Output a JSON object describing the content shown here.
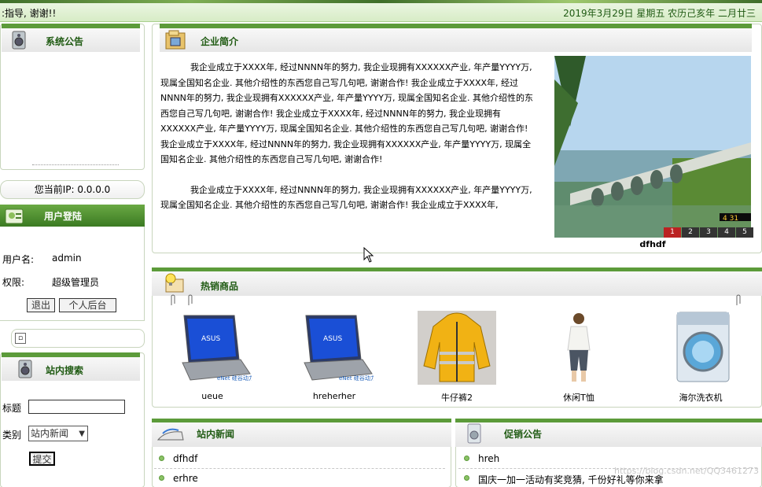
{
  "topbar": {
    "marquee": ":指导, 谢谢!!",
    "date": "2019年3月29日  星期五  农历己亥年  二月廿三"
  },
  "sidebar": {
    "notice_title": "系统公告",
    "ip_label": "您当前IP: 0.0.0.0",
    "login": {
      "title": "用户登陆",
      "username_label": "用户名:",
      "username_value": "admin",
      "role_label": "权限:",
      "role_value": "超级管理员",
      "logout_button": "退出",
      "backend_button": "个人后台"
    },
    "small_box_glyph": "▫",
    "search": {
      "title": "站内搜索",
      "title_label": "标题",
      "title_value": "",
      "category_label": "类别",
      "category_selected": "站内新闻",
      "submit_button": "提交"
    }
  },
  "intro": {
    "title": "企业简介",
    "paragraphs": [
      "我企业成立于XXXX年, 经过NNNN年的努力, 我企业现拥有XXXXXX产业, 年产量YYYY万, 现属全国知名企业. 其他介绍性的东西您自己写几句吧, 谢谢合作! 我企业成立于XXXX年, 经过NNNN年的努力, 我企业现拥有XXXXXX产业, 年产量YYYY万, 现属全国知名企业. 其他介绍性的东西您自己写几句吧, 谢谢合作! 我企业成立于XXXX年, 经过NNNN年的努力, 我企业现拥有XXXXXX产业, 年产量YYYY万, 现属全国知名企业. 其他介绍性的东西您自己写几句吧, 谢谢合作! 我企业成立于XXXX年, 经过NNNN年的努力, 我企业现拥有XXXXXX产业, 年产量YYYY万, 现属全国知名企业. 其他介绍性的东西您自己写几句吧, 谢谢合作!",
      "我企业成立于XXXX年, 经过NNNN年的努力, 我企业现拥有XXXXXX产业, 年产量YYYY万, 现属全国知名企业. 其他介绍性的东西您自己写几句吧, 谢谢合作! 我企业成立于XXXX年,"
    ],
    "photo_caption": "dfhdf",
    "photo_stamp": "4 31",
    "pager": [
      "1",
      "2",
      "3",
      "4",
      "5"
    ],
    "pager_active": "1"
  },
  "hot": {
    "title": "热销商品",
    "products": [
      {
        "name": "ueue",
        "kind": "laptop"
      },
      {
        "name": "hreherher",
        "kind": "laptop"
      },
      {
        "name": "牛仔裤2",
        "kind": "jacket"
      },
      {
        "name": "休闲T恤",
        "kind": "person"
      },
      {
        "name": "海尔洗衣机",
        "kind": "washer"
      }
    ],
    "laptop_brand": "ASUS",
    "laptop_badge": "eNet 硅谷动力"
  },
  "news": {
    "title": "站内新闻",
    "items": [
      "dfhdf",
      "erhre"
    ]
  },
  "promo": {
    "title": "促销公告",
    "items": [
      "hreh",
      "国庆一加一活动有奖竞猜, 千份好礼等你来拿"
    ]
  },
  "watermark": "https://blog.csdn.net/QQ3461273"
}
